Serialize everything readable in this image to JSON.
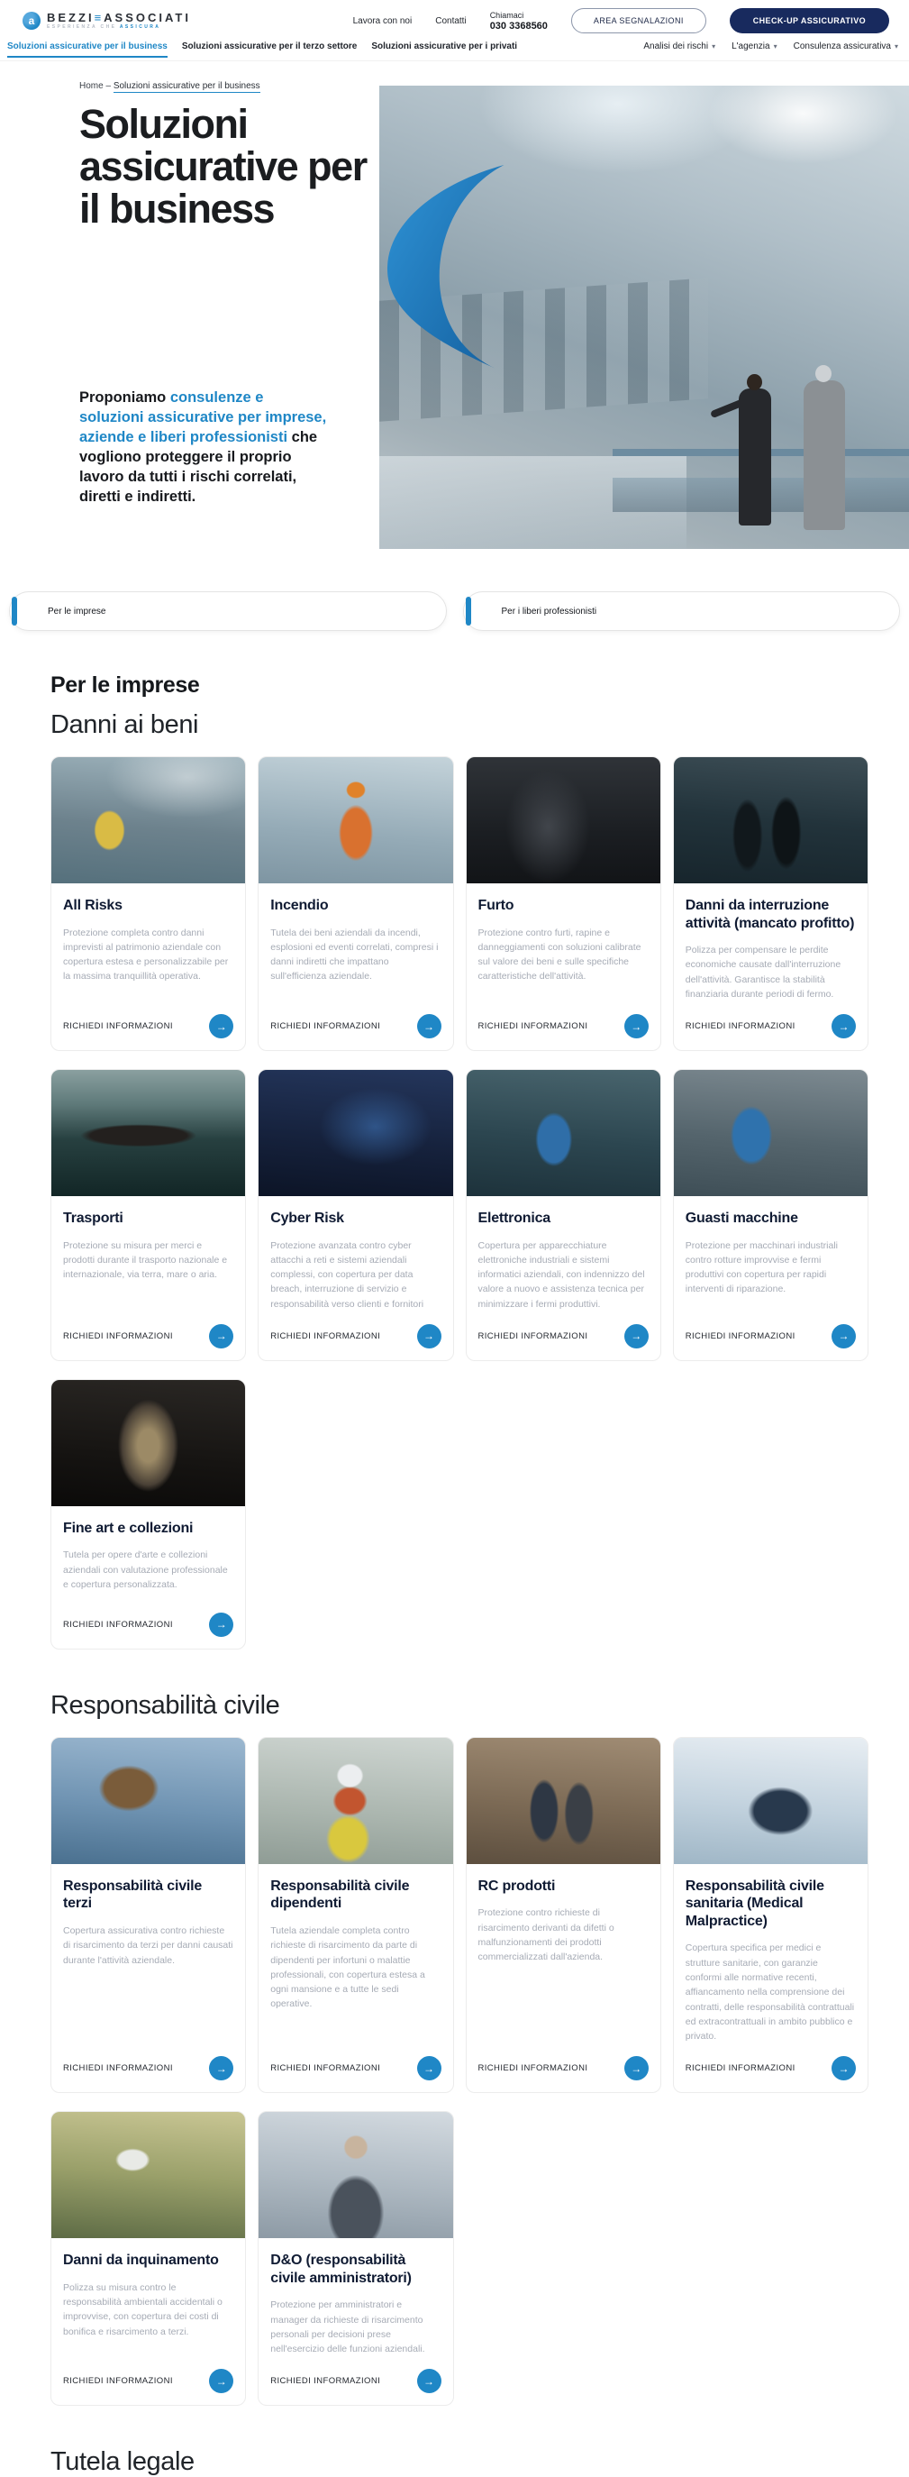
{
  "colors": {
    "accent": "#1f87c6",
    "navy": "#182a5e"
  },
  "icons": {
    "arrow": "→",
    "chevron": "▾"
  },
  "header": {
    "logo": {
      "part1": "BEZZI",
      "sep": "≡",
      "part2": "ASSOCIATI",
      "glyph": "a",
      "tagline_gray": "ESPERIENZA CHE",
      "tagline_blue": "ASSICURA"
    },
    "links": [
      {
        "label": "Lavora con noi"
      },
      {
        "label": "Contatti"
      }
    ],
    "call": {
      "label": "Chiamaci",
      "phone": "030 3368560"
    },
    "buttons": {
      "area": "AREA SEGNALAZIONI",
      "checkup": "CHECK-UP ASSICURATIVO"
    }
  },
  "subnav": {
    "items": [
      {
        "label": "Soluzioni assicurative per il business"
      },
      {
        "label": "Soluzioni assicurative per il terzo settore"
      },
      {
        "label": "Soluzioni assicurative per i privati"
      }
    ],
    "dropdowns": [
      {
        "label": "Analisi dei rischi"
      },
      {
        "label": "L'agenzia"
      },
      {
        "label": "Consulenza assicurativa"
      }
    ]
  },
  "breadcrumb": {
    "home": "Home",
    "sep": "–",
    "current": "Soluzioni assicurative per il business"
  },
  "hero": {
    "title": "Soluzioni assicurative per il business",
    "intro_dark1": "Proponiamo ",
    "intro_blue": "consulenze e soluzioni assicurative per imprese, aziende e liberi professionisti",
    "intro_dark2": " che vogliono proteggere il proprio lavoro da tutti i rischi correlati, diretti e indiretti."
  },
  "tabs": [
    {
      "label": "Per le imprese"
    },
    {
      "label": "Per i liberi professionisti"
    }
  ],
  "cta_label": "RICHIEDI INFORMAZIONI",
  "sections": {
    "imprese_heading": "Per le imprese",
    "danni_heading": "Danni ai beni",
    "danni_cards": [
      {
        "title": "All Risks",
        "desc": "Protezione completa contro danni imprevisti al patrimonio aziendale con copertura estesa e personalizzabile per la massima tranquillità operativa."
      },
      {
        "title": "Incendio",
        "desc": "Tutela dei beni aziendali da incendi, esplosioni ed eventi correlati, compresi i danni indiretti che impattano sull'efficienza aziendale."
      },
      {
        "title": "Furto",
        "desc": "Protezione contro furti, rapine e danneggiamenti con soluzioni calibrate sul valore dei beni e sulle specifiche caratteristiche dell'attività."
      },
      {
        "title": "Danni da interruzione attività (mancato profitto)",
        "desc": "Polizza per compensare le perdite economiche causate dall'interruzione dell'attività. Garantisce la stabilità finanziaria durante periodi di fermo."
      },
      {
        "title": "Trasporti",
        "desc": "Protezione su misura per merci e prodotti durante il trasporto nazionale e internazionale, via terra, mare o aria."
      },
      {
        "title": "Cyber Risk",
        "desc": "Protezione avanzata contro cyber attacchi a reti e sistemi aziendali complessi, con copertura per data breach, interruzione di servizio e responsabilità verso clienti e fornitori"
      },
      {
        "title": "Elettronica",
        "desc": "Copertura per apparecchiature elettroniche industriali e sistemi informatici aziendali, con indennizzo del valore a nuovo e assistenza tecnica per minimizzare i fermi produttivi."
      },
      {
        "title": "Guasti macchine",
        "desc": "Protezione per macchinari industriali contro rotture improvvise e fermi produttivi con copertura per rapidi interventi di riparazione."
      },
      {
        "title": "Fine art e collezioni",
        "desc": "Tutela per opere d'arte e collezioni aziendali con valutazione professionale e copertura personalizzata."
      }
    ],
    "rc_heading": "Responsabilità civile",
    "rc_cards": [
      {
        "title": "Responsabilità civile terzi",
        "desc": "Copertura assicurativa contro richieste di risarcimento da terzi per danni causati durante l'attività aziendale."
      },
      {
        "title": "Responsabilità civile dipendenti",
        "desc": "Tutela aziendale completa contro richieste di risarcimento da parte di dipendenti per infortuni o malattie professionali, con copertura estesa a ogni mansione e a tutte le sedi operative."
      },
      {
        "title": "RC prodotti",
        "desc": "Protezione contro richieste di risarcimento derivanti da difetti o malfunzionamenti dei prodotti commercializzati dall'azienda."
      },
      {
        "title": "Responsabilità civile sanitaria (Medical Malpractice)",
        "desc": "Copertura specifica per medici e strutture sanitarie, con garanzie conformi alle normative recenti, affiancamento nella comprensione dei contratti, delle responsabilità contrattuali ed extracontrattuali in ambito pubblico e privato."
      },
      {
        "title": "Danni da inquinamento",
        "desc": "Polizza su misura contro le responsabilità ambientali accidentali o improvvise, con copertura dei costi di bonifica e risarcimento a terzi."
      },
      {
        "title": "D&O (responsabilità civile amministratori)",
        "desc": "Protezione per amministratori e manager da richieste di risarcimento personali per decisioni prese nell'esercizio delle funzioni aziendali."
      }
    ],
    "tutela_heading": "Tutela legale"
  }
}
